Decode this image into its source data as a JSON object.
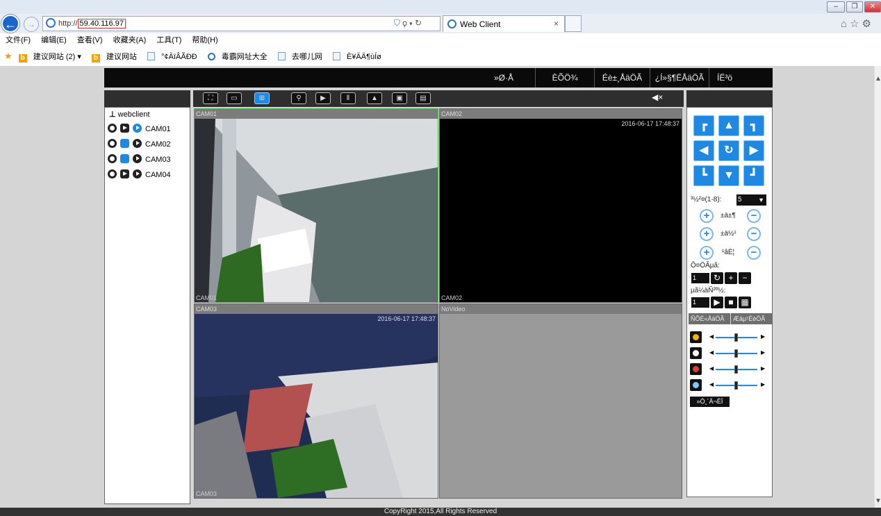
{
  "browser": {
    "url_prefix": "http://",
    "url_host": "59.40.116.97",
    "tab_title": "Web Client",
    "tab_close": "×",
    "window_buttons": [
      "–",
      "❐",
      "✕"
    ],
    "menu": [
      "文件(F)",
      "编辑(E)",
      "查看(V)",
      "收藏夹(A)",
      "工具(T)",
      "帮助(H)"
    ],
    "favorites": [
      {
        "label": "建议网站 (2) ▾",
        "icon": "bing-icon"
      },
      {
        "label": "建议网站",
        "icon": "bing-icon"
      },
      {
        "label": "°¢ÀïÂÃÐÐ",
        "icon": "page-icon"
      },
      {
        "label": "毒霸网址大全",
        "icon": "ie-icon"
      },
      {
        "label": "去哪儿网",
        "icon": "page-icon"
      },
      {
        "label": "È¥ÄÄ¶ùÍø",
        "icon": "page-icon"
      }
    ]
  },
  "app": {
    "nav": [
      "»Ø·Å",
      "ÈÕÖ¾",
      "Éè±¸ÅäÖÃ",
      "¿Í»§¶ËÅäÖÃ",
      "ÍË³ö"
    ],
    "tree_root": "webclient",
    "cameras": [
      {
        "name": "CAM01",
        "buttons": [
          "rec",
          "play",
          "circblue"
        ]
      },
      {
        "name": "CAM02",
        "buttons": [
          "rec",
          "blue",
          "circplay"
        ]
      },
      {
        "name": "CAM03",
        "buttons": [
          "rec",
          "blue",
          "circplay"
        ]
      },
      {
        "name": "CAM04",
        "buttons": [
          "rec",
          "play",
          "circplay"
        ]
      }
    ],
    "toolbar_icons": [
      "fullscreen-icon",
      "single-view-icon",
      "quad-view-icon",
      "zoom-icon",
      "play-icon",
      "pause-icon",
      "snapshot-icon",
      "record-icon",
      "record-all-icon"
    ],
    "mute_icon": "mute-icon",
    "video": [
      {
        "header": "CAM01",
        "timestamp": "2016-06-17 17:48:37",
        "footer": "CAM01",
        "selected": true
      },
      {
        "header": "CAM02",
        "timestamp": "2016-06-17 17:48:37",
        "footer": "CAM02",
        "selected": false
      },
      {
        "header": "CAM03",
        "timestamp": "2016-06-17 17:48:37",
        "footer": "CAM03",
        "selected": false
      },
      {
        "header": "NoVideo",
        "timestamp": "",
        "footer": "",
        "selected": false
      }
    ],
    "ptz": {
      "speed_label": "³½²¤(1-8):",
      "speed_value": "5",
      "zoom_label": "±ä±¶",
      "focus_label": "±ä½¹",
      "iris_label": "¹âÈ¦",
      "preset_label": "Ô¤ÖÃµã:",
      "preset_value": "1",
      "cruise_label": "µã¼äÑ²º½:",
      "cruise_value": "1"
    },
    "image_tabs": [
      "ÑÕÉ«ÅäÖÃ",
      "Æäµ¹ÉèÖÃ"
    ],
    "sliders": [
      {
        "icon": "brightness-icon",
        "value": 0.5
      },
      {
        "icon": "contrast-icon",
        "value": 0.5
      },
      {
        "icon": "saturation-icon",
        "value": 0.5
      },
      {
        "icon": "hue-icon",
        "value": 0.5
      }
    ],
    "reset_label": "»Ö¸´Ä¬ÈÏ",
    "footer": "CopyRight 2015,All Rights Reserved"
  }
}
